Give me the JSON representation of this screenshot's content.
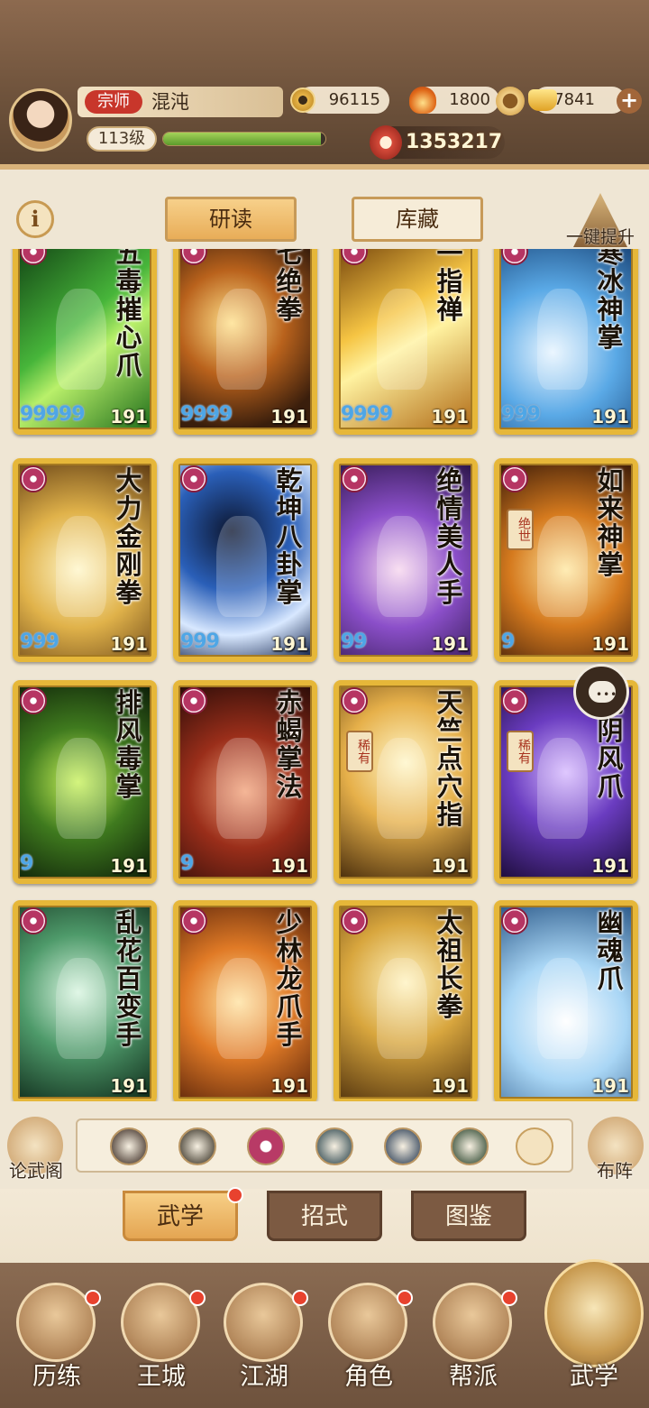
{
  "player": {
    "rank_label": "宗师",
    "name": "混沌",
    "level": "113级",
    "xp_fraction": 0.97,
    "power": "1353217"
  },
  "currency": {
    "silver": "96115",
    "fire": "1800",
    "gold": "7841"
  },
  "tabs": [
    {
      "label": "研读"
    },
    {
      "label": "库藏"
    }
  ],
  "one_key_label": "一键提升",
  "cards": [
    {
      "name": "五毒摧心爪",
      "level": "191",
      "drops": "99999",
      "bg": "linear-gradient(140deg,#0f3d12,#47b53a 45%,#b9f06a 60%,#1f6d1a)",
      "tag": ""
    },
    {
      "name": "七绝拳",
      "level": "191",
      "drops": "9999",
      "bg": "radial-gradient(circle at 40% 45%,#ffe08a,#b9621c 40%,#3a1e0c 80%)",
      "tag": ""
    },
    {
      "name": "一指禅",
      "level": "191",
      "drops": "9999",
      "bg": "linear-gradient(150deg,#6a3a08,#f5c443 40%,#fff2a0 55%,#b06a15)",
      "tag": ""
    },
    {
      "name": "寒冰神掌",
      "level": "191",
      "drops": "999",
      "bg": "radial-gradient(circle at 40% 60%,#e6f4ff,#5aa9e6 45%,#123b6e)",
      "tag": ""
    },
    {
      "name": "大力金刚拳",
      "level": "191",
      "drops": "999",
      "bg": "radial-gradient(circle at 45% 55%,#fff6c8,#e0b24a 45%,#5e3a12)",
      "tag": ""
    },
    {
      "name": "乾坤八卦掌",
      "level": "191",
      "drops": "999",
      "bg": "radial-gradient(circle at 40% 35%,#0c1630,#2a5fb8 40%,#d8e8ff 70%,#10214a)",
      "tag": ""
    },
    {
      "name": "绝情美人手",
      "level": "191",
      "drops": "99",
      "bg": "radial-gradient(circle at 45% 55%,#f7d6ee,#8b4fc9 45%,#2a1547)",
      "tag": ""
    },
    {
      "name": "如来神掌",
      "level": "191",
      "drops": "9",
      "bg": "radial-gradient(circle at 50% 55%,#ffe7a0,#d57a1e 45%,#3a1a08)",
      "tag": "绝世"
    },
    {
      "name": "排风毒掌",
      "level": "191",
      "drops": "9",
      "bg": "radial-gradient(circle at 45% 50%,#c8f25a,#3f7a1e 45%,#0c1d08)",
      "tag": ""
    },
    {
      "name": "赤蝎掌法",
      "level": "191",
      "drops": "9",
      "bg": "radial-gradient(circle at 50% 55%,#f2a27a,#9a2e1a 45%,#2a0c08)",
      "tag": ""
    },
    {
      "name": "天竺点穴指",
      "level": "191",
      "drops": "",
      "bg": "radial-gradient(circle at 50% 40%,#fff6c8,#e6b04a 45%,#4a2e0c)",
      "tag": "稀有"
    },
    {
      "name": "魂阴风爪",
      "level": "191",
      "drops": "",
      "bg": "radial-gradient(circle at 50% 45%,#d6b8ff,#6a3cc0 45%,#1c0c3a)",
      "tag": "稀有"
    },
    {
      "name": "乱花百变手",
      "level": "191",
      "drops": "",
      "bg": "radial-gradient(circle at 45% 45%,#d8f5e0,#4e9a6a 45%,#0f2a1a)",
      "tag": ""
    },
    {
      "name": "少林龙爪手",
      "level": "191",
      "drops": "",
      "bg": "radial-gradient(circle at 45% 50%,#ffe2a0,#e07a26 45%,#5a240a)",
      "tag": ""
    },
    {
      "name": "太祖长拳",
      "level": "191",
      "drops": "",
      "bg": "radial-gradient(circle at 50% 40%,#fff3c0,#d8a63e 45%,#5a3a10)",
      "tag": ""
    },
    {
      "name": "幽魂爪",
      "level": "191",
      "drops": "",
      "bg": "radial-gradient(circle at 50% 60%,#ffffff,#a9d6f5 45%,#2c5a8a)",
      "tag": ""
    }
  ],
  "filter_icons": [
    {
      "name": "weapon-icon",
      "color": "#2e1e16"
    },
    {
      "name": "sword-icon",
      "color": "#2a2418"
    },
    {
      "name": "palm-icon",
      "color": "#b83a66"
    },
    {
      "name": "fan-icon",
      "color": "#1e3a44"
    },
    {
      "name": "taichi-icon",
      "color": "#1a2f4a"
    },
    {
      "name": "pot-icon",
      "color": "#1e3a22"
    }
  ],
  "side": {
    "left_label": "论武阁",
    "right_label": "布阵"
  },
  "subtabs": [
    {
      "label": "武学"
    },
    {
      "label": "招式"
    },
    {
      "label": "图鉴"
    }
  ],
  "nav": [
    {
      "label": "历练"
    },
    {
      "label": "王城"
    },
    {
      "label": "江湖"
    },
    {
      "label": "角色"
    },
    {
      "label": "帮派"
    },
    {
      "label": "武学"
    }
  ]
}
